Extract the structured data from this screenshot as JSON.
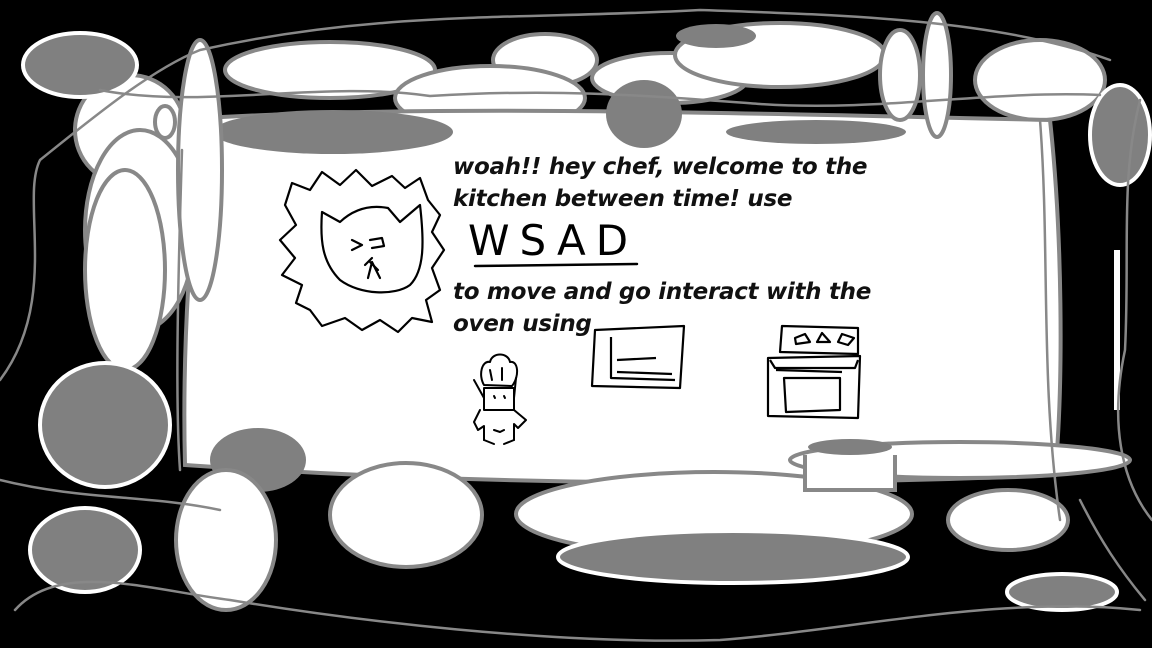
{
  "dialog": {
    "line_1a": "woah!! hey chef, welcome to the",
    "line_1b": "kitchen between time! use",
    "keys": "WSAD",
    "line_2a": "to move and go interact with the",
    "line_2b": "oven using"
  },
  "icons": {
    "speaker": "cat-face-icon",
    "player": "chef-icon",
    "action": "microwave-icon",
    "target": "oven-icon"
  },
  "colors": {
    "background": "#000000",
    "blob_white": "#ffffff",
    "blob_gray": "#808080",
    "outline_gray": "#888888",
    "ink": "#111111"
  }
}
